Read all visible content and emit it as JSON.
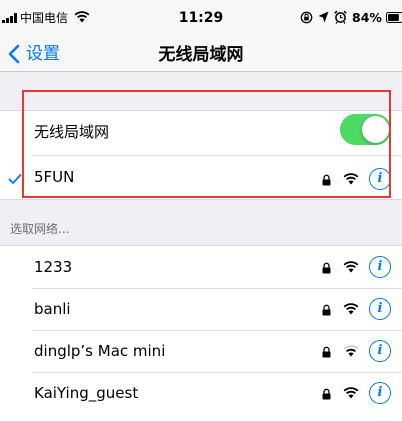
{
  "status_bar": {
    "carrier": "中国电信",
    "time": "11:29",
    "battery_percent": "84%",
    "battery_level": 0.84
  },
  "nav": {
    "back_label": "设置",
    "title": "无线局域网"
  },
  "wifi_toggle": {
    "label": "无线局域网",
    "on": true,
    "color": "#4cd964"
  },
  "connected_network": {
    "name": "5FUN",
    "secured": true
  },
  "section": {
    "header": "选取网络..."
  },
  "networks": [
    {
      "name": "1233",
      "secured": true
    },
    {
      "name": "banli",
      "secured": true
    },
    {
      "name": "dinglp’s Mac mini",
      "secured": true
    },
    {
      "name": "KaiYing_guest",
      "secured": true
    }
  ],
  "colors": {
    "accent": "#007aff",
    "highlight": "#e53935"
  }
}
